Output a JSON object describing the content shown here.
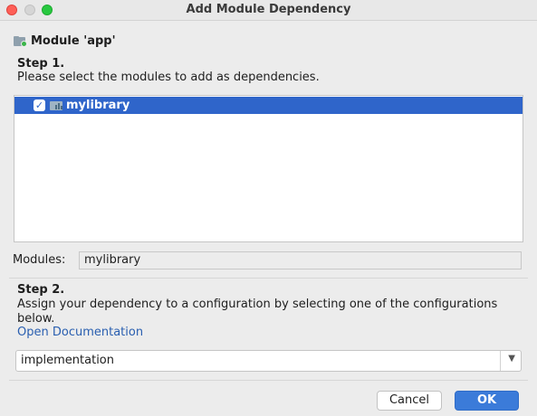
{
  "window": {
    "title": "Add Module Dependency"
  },
  "header": {
    "module_label": "Module 'app'",
    "icon": "module-folder-icon"
  },
  "step1": {
    "title": "Step 1.",
    "description": "Please select the modules to add as dependencies.",
    "modules_list": [
      {
        "label": "mylibrary",
        "checked": true,
        "selected": true,
        "icon": "library-module-icon"
      }
    ]
  },
  "modules_field": {
    "label": "Modules:",
    "value": "mylibrary"
  },
  "step2": {
    "title": "Step 2.",
    "description": "Assign your dependency to a configuration by selecting one of the configurations below.",
    "link": "Open Documentation",
    "configuration": {
      "selected": "implementation"
    }
  },
  "footer": {
    "cancel_label": "Cancel",
    "ok_label": "OK"
  },
  "colors": {
    "selection": "#2f65ca",
    "ok_button": "#3b7bd9",
    "link": "#2a5fb0"
  }
}
